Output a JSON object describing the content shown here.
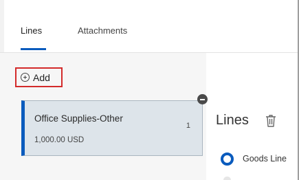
{
  "tabs": [
    {
      "label": "Lines"
    },
    {
      "label": "Attachments"
    }
  ],
  "add_button": {
    "label": "Add",
    "icon": "plus-circle-icon",
    "highlight_color": "#d32a2a"
  },
  "line_card": {
    "title": "Office Supplies-Other",
    "count": "1",
    "amount": "1,000.00 USD",
    "accent_color": "#0a5bbd"
  },
  "detail": {
    "heading": "Lines",
    "delete_icon": "trash-icon",
    "options": [
      {
        "label": "Goods Line",
        "selected": true
      }
    ]
  },
  "colors": {
    "accent": "#0a5bbd",
    "card_background": "#dde4ea"
  }
}
